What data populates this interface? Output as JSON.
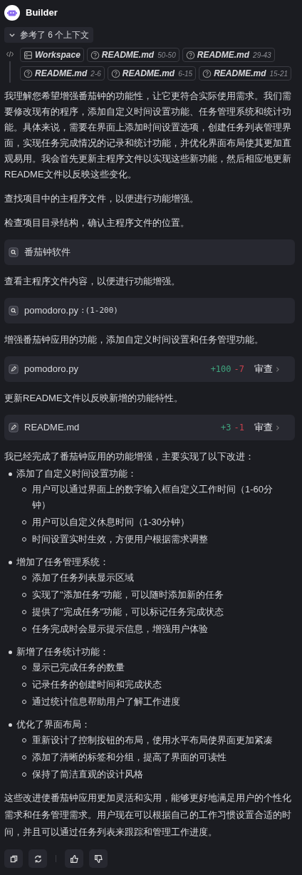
{
  "header": {
    "title": "Builder"
  },
  "context": {
    "label": "参考了 6 个上下文",
    "expanded": true,
    "chips": [
      {
        "kind": "workspace",
        "name": "Workspace"
      },
      {
        "kind": "file",
        "name": "README.md",
        "range": "50-50"
      },
      {
        "kind": "file",
        "name": "README.md",
        "range": "29-43"
      },
      {
        "kind": "file",
        "name": "README.md",
        "range": "2-6"
      },
      {
        "kind": "file",
        "name": "README.md",
        "range": "6-15"
      },
      {
        "kind": "file",
        "name": "README.md",
        "range": "15-21"
      }
    ]
  },
  "steps": [
    {
      "kind": "text",
      "text": "我理解您希望增强番茄钟的功能性，让它更符合实际使用需求。我们需要修改现有的程序，添加自定义时间设置功能、任务管理系统和统计功能。具体来说，需要在界面上添加时间设置选项，创建任务列表管理界面，实现任务完成情况的记录和统计功能，并优化界面布局使其更加直观易用。我会首先更新主程序文件以实现这些新功能，然后相应地更新README文件以反映这些变化。"
    },
    {
      "kind": "text",
      "text": "查找项目中的主程序文件，以便进行功能增强。"
    },
    {
      "kind": "text",
      "text": "检查项目目录结构，确认主程序文件的位置。"
    },
    {
      "kind": "search",
      "query": "番茄钟软件"
    },
    {
      "kind": "text",
      "text": "查看主程序文件内容，以便进行功能增强。"
    },
    {
      "kind": "search",
      "query": "pomodoro.py",
      "range": ":(1-200)"
    },
    {
      "kind": "text",
      "text": "增强番茄钟应用的功能，添加自定义时间设置和任务管理功能。"
    },
    {
      "kind": "edit",
      "file": "pomodoro.py",
      "added": "+100",
      "removed": "-7",
      "action": "审查"
    },
    {
      "kind": "text",
      "text": "更新README文件以反映新增的功能特性。"
    },
    {
      "kind": "edit",
      "file": "README.md",
      "added": "+3",
      "removed": "-1",
      "action": "审查"
    }
  ],
  "summary": {
    "intro": "我已经完成了番茄钟应用的功能增强，主要实现了以下改进：",
    "sections": [
      {
        "title": "添加了自定义时间设置功能：",
        "items": [
          "用户可以通过界面上的数字输入框自定义工作时间（1-60分钟）",
          "用户可以自定义休息时间（1-30分钟）",
          "时间设置实时生效，方便用户根据需求调整"
        ]
      },
      {
        "title": "增加了任务管理系统：",
        "items": [
          "添加了任务列表显示区域",
          "实现了\"添加任务\"功能，可以随时添加新的任务",
          "提供了\"完成任务\"功能，可以标记任务完成状态",
          "任务完成时会显示提示信息，增强用户体验"
        ]
      },
      {
        "title": "新增了任务统计功能：",
        "items": [
          "显示已完成任务的数量",
          "记录任务的创建时间和完成状态",
          "通过统计信息帮助用户了解工作进度"
        ]
      },
      {
        "title": "优化了界面布局：",
        "items": [
          "重新设计了控制按钮的布局，使用水平布局使界面更加紧凑",
          "添加了清晰的标签和分组，提高了界面的可读性",
          "保持了简洁直观的设计风格"
        ]
      }
    ],
    "conclusion": "这些改进使番茄钟应用更加灵活和实用，能够更好地满足用户的个性化需求和任务管理需求。用户现在可以根据自己的工作习惯设置合适的时间，并且可以通过任务列表来跟踪和管理工作进度。"
  },
  "actions": [
    {
      "kind": "copy"
    },
    {
      "kind": "regenerate"
    },
    {
      "kind": "divider"
    },
    {
      "kind": "like"
    },
    {
      "kind": "dislike"
    }
  ]
}
